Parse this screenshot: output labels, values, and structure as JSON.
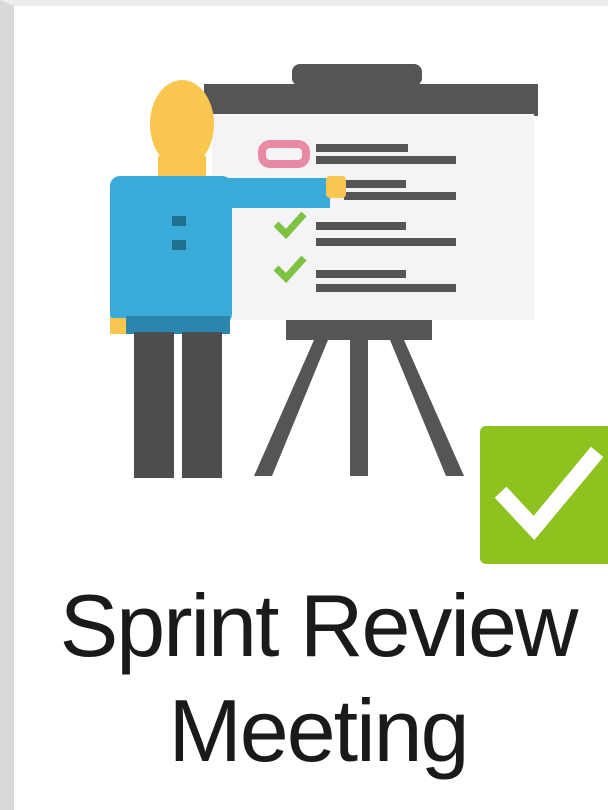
{
  "tile": {
    "label_line1": "Sprint Review",
    "label_line2": "Meeting",
    "icon": "presentation-board-icon",
    "badge_icon": "checkmark-badge-icon"
  },
  "colors": {
    "person_head": "#f9c74f",
    "person_shirt": "#3aaad8",
    "person_legs": "#4d4d4d",
    "board": "#f4f4f6",
    "board_frame": "#555555",
    "check_green": "#7ec242",
    "badge_green": "#8dc21f",
    "pink_item": "#e88aa3"
  }
}
